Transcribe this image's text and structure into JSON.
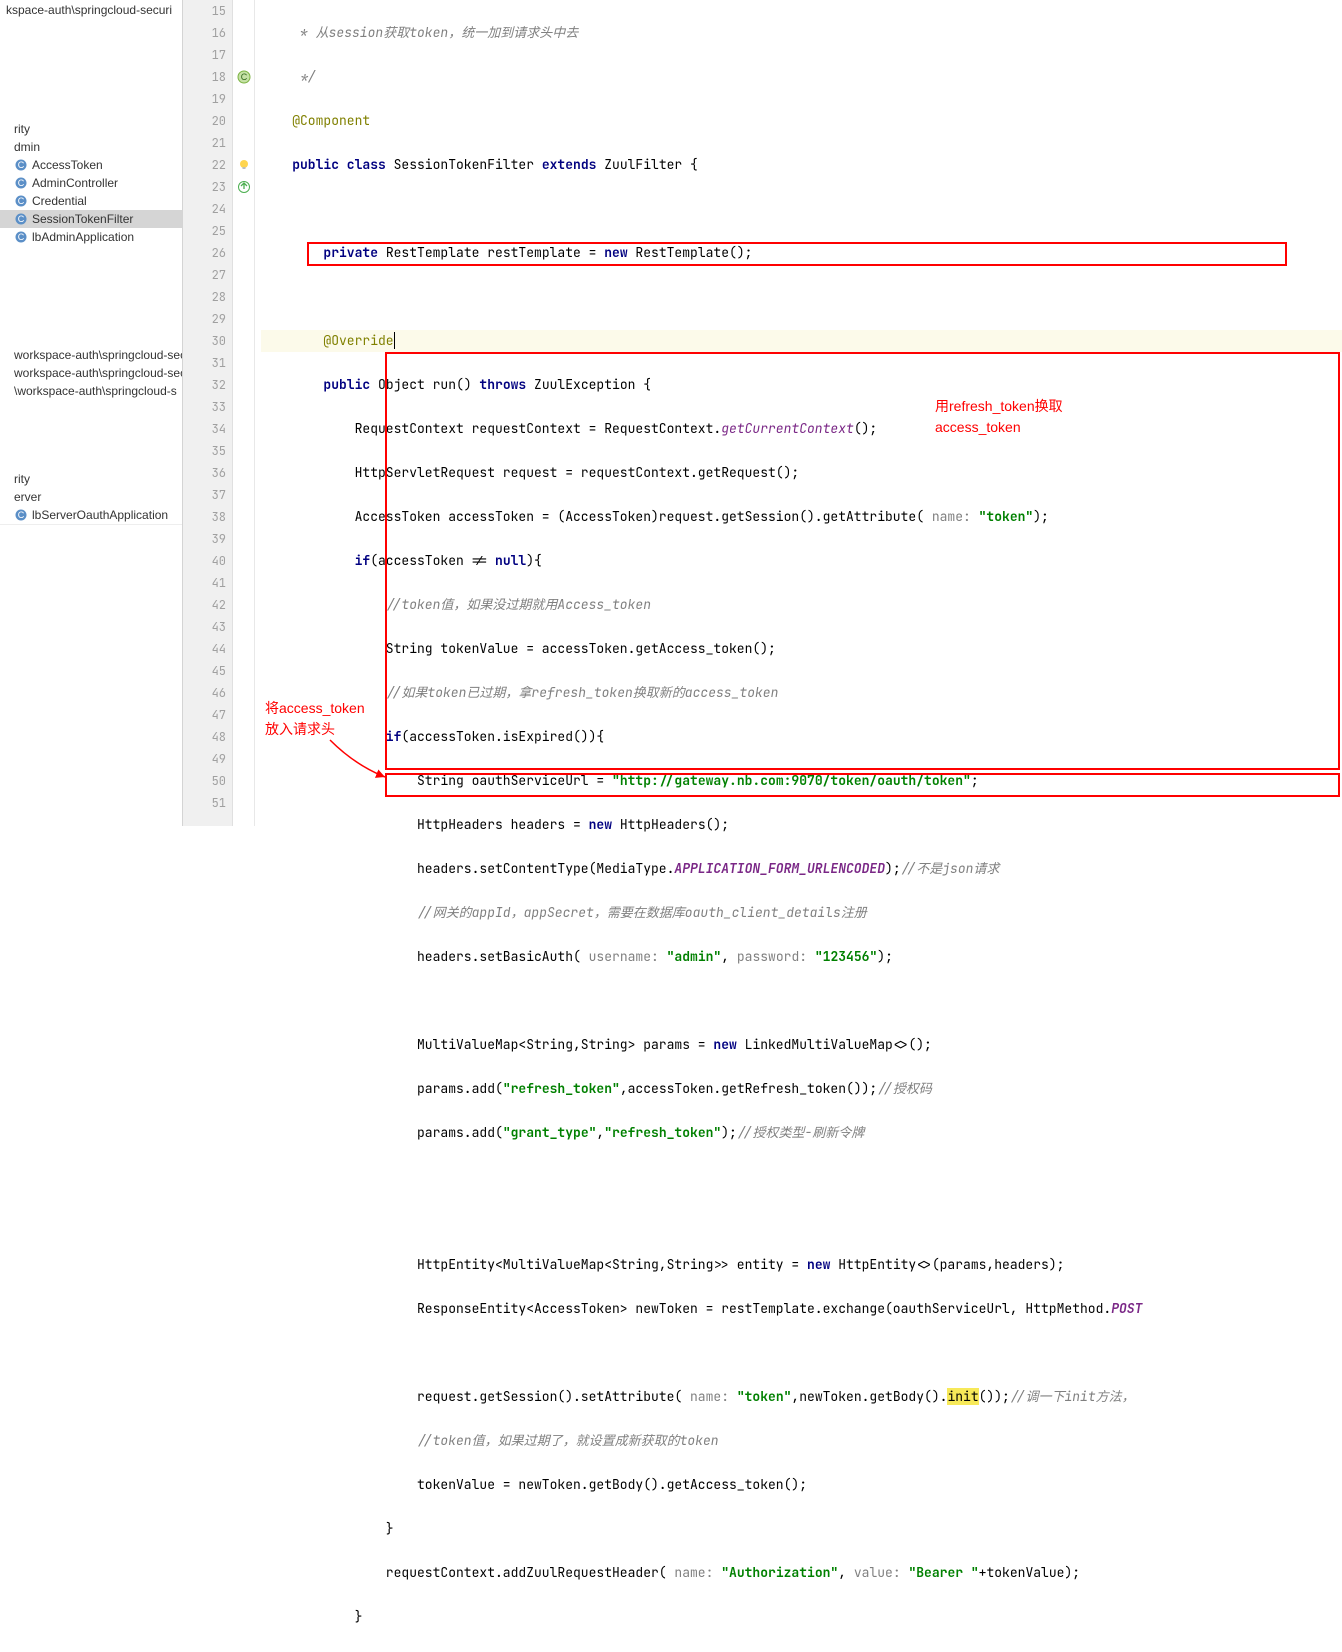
{
  "sidebar": {
    "path_top": "kspace-auth\\springcloud-securi",
    "items1": [
      "rity",
      "dmin"
    ],
    "classes": [
      "AccessToken",
      "AdminController",
      "Credential",
      "SessionTokenFilter",
      "lbAdminApplication"
    ],
    "paths": [
      "workspace-auth\\springcloud-sec",
      "workspace-auth\\springcloud-sec",
      "\\workspace-auth\\springcloud-s"
    ],
    "items2": [
      "rity",
      "erver",
      "lbServerOauthApplication"
    ]
  },
  "gutter": {
    "start": 15,
    "end": 51
  },
  "code": {
    "l15": "     * 从session获取token，统一加到请求头中去",
    "l16": "     */",
    "l17": "    @Component",
    "l18_1": "    public class ",
    "l18_2": "SessionTokenFilter ",
    "l18_3": "extends ",
    "l18_4": "ZuulFilter {",
    "l20_1": "        private ",
    "l20_2": "RestTemplate restTemplate = ",
    "l20_3": "new ",
    "l20_4": "RestTemplate();",
    "l22": "        @Override",
    "l23_1": "        public ",
    "l23_2": "Object run() ",
    "l23_3": "throws ",
    "l23_4": "ZuulException {",
    "l24_1": "            RequestContext requestContext = RequestContext.",
    "l24_2": "getCurrentContext",
    "l24_3": "();",
    "l25": "            HttpServletRequest request = requestContext.getRequest();",
    "l26_1": "            AccessToken accessToken = (AccessToken)request.getSession().getAttribute(",
    "l26_p": " name: ",
    "l26_s": "\"token\"",
    "l26_e": ");",
    "l27_1": "            if",
    "l27_2": "(accessToken != ",
    "l27_3": "null",
    "l27_4": "){",
    "l28": "                //token值，如果没过期就用Access_token",
    "l29": "                String tokenValue = accessToken.getAccess_token();",
    "l30": "                //如果token已过期，拿refresh_token换取新的access_token",
    "l31_1": "                if",
    "l31_2": "(accessToken.isExpired()){",
    "l32_1": "                    String oauthServiceUrl = ",
    "l32_2": "\"http://gateway.nb.com:9070/token/oauth/token\"",
    "l32_3": ";",
    "l33_1": "                    HttpHeaders headers = ",
    "l33_2": "new ",
    "l33_3": "HttpHeaders();",
    "l34_1": "                    headers.setContentType(MediaType.",
    "l34_2": "APPLICATION_FORM_URLENCODED",
    "l34_3": ");",
    "l34_4": "//不是json请求",
    "l35": "                    //网关的appId，appSecret，需要在数据库oauth_client_details注册",
    "l36_1": "                    headers.setBasicAuth(",
    "l36_p1": " username: ",
    "l36_s1": "\"admin\"",
    "l36_c": ", ",
    "l36_p2": "password: ",
    "l36_s2": "\"123456\"",
    "l36_e": ");",
    "l38_1": "                    MultiValueMap<String,String> params = ",
    "l38_2": "new ",
    "l38_3": "LinkedMultiValueMap<>();",
    "l39_1": "                    params.add(",
    "l39_2": "\"refresh_token\"",
    "l39_3": ",accessToken.getRefresh_token());",
    "l39_4": "//授权码",
    "l40_1": "                    params.add(",
    "l40_2": "\"grant_type\"",
    "l40_3": ",",
    "l40_4": "\"refresh_token\"",
    "l40_5": ");",
    "l40_6": "//授权类型-刷新令牌",
    "l43_1": "                    HttpEntity<MultiValueMap<String,String>> entity = ",
    "l43_2": "new ",
    "l43_3": "HttpEntity<>(params,headers);",
    "l44_1": "                    ResponseEntity<AccessToken> newToken = restTemplate.exchange(oauthServiceUrl, HttpMethod.",
    "l44_2": "POST",
    "l46_1": "                    request.getSession().setAttribute(",
    "l46_p": " name: ",
    "l46_s": "\"token\"",
    "l46_2": ",newToken.getBody().",
    "l46_3": "init",
    "l46_4": "());",
    "l46_5": "//调一下init方法，",
    "l47": "                    //token值，如果过期了，就设置成新获取的token",
    "l48": "                    tokenValue = newToken.getBody().getAccess_token();",
    "l49": "                }",
    "l50_1": "                requestContext.addZuulRequestHeader(",
    "l50_p1": " name: ",
    "l50_s1": "\"Authorization\"",
    "l50_c": ", ",
    "l50_p2": "value: ",
    "l50_s2": "\"Bearer \"",
    "l50_e": "+tokenValue);",
    "l51": "            }"
  },
  "annotations": {
    "a1_l1": "将access_token",
    "a1_l2": "放入请求头",
    "a2_l1": "用refresh_token换取",
    "a2_l2": "access_token"
  }
}
